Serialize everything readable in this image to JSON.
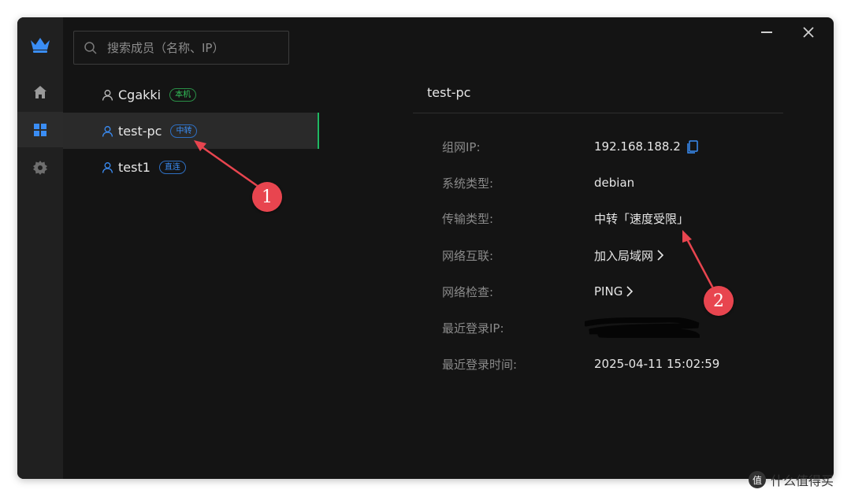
{
  "search": {
    "placeholder": "搜索成员（名称、IP）"
  },
  "rail": {
    "logo_icon": "crown-icon",
    "items": [
      {
        "icon": "home-icon"
      },
      {
        "icon": "grid-icon",
        "active": true
      },
      {
        "icon": "gear-icon"
      }
    ]
  },
  "members": [
    {
      "name": "Cgakki",
      "badge": "本机",
      "badge_color": "#33c25a"
    },
    {
      "name": "test-pc",
      "badge": "中转",
      "badge_color": "#3a8df5",
      "selected": true
    },
    {
      "name": "test1",
      "badge": "直连",
      "badge_color": "#3a8df5"
    }
  ],
  "detail": {
    "title": "test-pc",
    "rows": [
      {
        "label": "组网IP:",
        "value": "192.168.188.2"
      },
      {
        "label": "系统类型:",
        "value": "debian"
      },
      {
        "label": "传输类型:",
        "value": "中转「速度受限」"
      },
      {
        "label": "网络互联:",
        "value": "加入局域网"
      },
      {
        "label": "网络检查:",
        "value": "PING"
      },
      {
        "label": "最近登录IP:",
        "value": ""
      },
      {
        "label": "最近登录时间:",
        "value": "2025-04-11 15:02:59"
      }
    ]
  },
  "annotations": {
    "one": "1",
    "two": "2"
  },
  "watermark": {
    "text": "什么值得买",
    "logo": "值"
  },
  "colors": {
    "accent_green": "#1fb862",
    "annotation_red": "#e8454f",
    "link_blue": "#3a8df5"
  }
}
